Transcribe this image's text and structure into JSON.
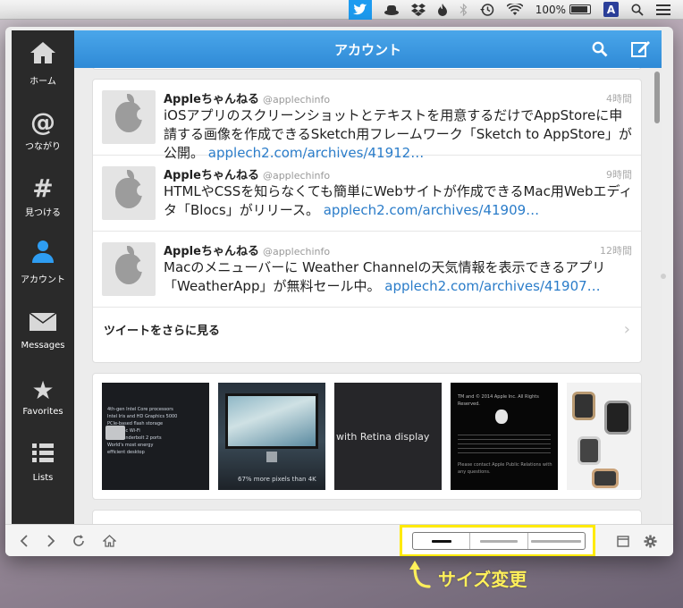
{
  "menubar": {
    "battery_text": "100%",
    "input_method": "A",
    "icons": [
      "twitter-icon",
      "hat-icon",
      "dropbox-icon",
      "flame-icon",
      "bluetooth-icon",
      "time-machine-icon",
      "wifi-icon",
      "battery-icon",
      "input-method-icon",
      "spotlight-icon",
      "menu-list-icon"
    ]
  },
  "sidebar": {
    "items": [
      {
        "label": "ホーム",
        "icon": "home-icon"
      },
      {
        "label": "つながり",
        "icon": "at-icon"
      },
      {
        "label": "見つける",
        "icon": "hashtag-icon"
      },
      {
        "label": "アカウント",
        "icon": "person-icon"
      },
      {
        "label": "Messages",
        "icon": "envelope-icon"
      },
      {
        "label": "Favorites",
        "icon": "star-icon"
      },
      {
        "label": "Lists",
        "icon": "list-icon"
      }
    ],
    "active_index": 3
  },
  "header": {
    "title": "アカウント"
  },
  "tweets": [
    {
      "name": "Appleちゃんねる",
      "handle": "@applechinfo",
      "time": "4時間",
      "text": "iOSアプリのスクリーンショットとテキストを用意するだけでAppStoreに申請する画像を作成できるSketch用フレームワーク「Sketch to AppStore」が公開。",
      "link": "applech2.com/archives/41912…"
    },
    {
      "name": "Appleちゃんねる",
      "handle": "@applechinfo",
      "time": "9時間",
      "text": "HTMLやCSSを知らなくても簡単にWebサイトが作成できるMac用Webエディタ「Blocs」がリリース。",
      "link": "applech2.com/archives/41909…"
    },
    {
      "name": "Appleちゃんねる",
      "handle": "@applechinfo",
      "time": "12時間",
      "text": "Macのメニューバーに Weather Channelの天気情報を表示できるアプリ「WeatherApp」が無料セール中。",
      "link": "applech2.com/archives/41907…"
    }
  ],
  "more_tweets_label": "ツイートをさらに見る",
  "media": [
    {
      "lines": [
        "4th-gen Intel Core processors",
        "Intel Iris and HD Graphics 5000",
        "PCIe-based flash storage",
        "802.11ac Wi-Fi",
        "Two Thunderbolt 2 ports",
        "World's most energy",
        "efficient desktop"
      ]
    },
    {
      "caption": "67% more pixels than 4K"
    },
    {
      "caption": "with Retina display"
    },
    {
      "lines": [
        "TM and © 2014 Apple Inc. All Rights Reserved."
      ],
      "footer": "Please contact Apple Public Relations with any questions."
    },
    {
      "caption": ""
    }
  ],
  "toolbar": {
    "size_options": [
      "small",
      "medium",
      "large"
    ],
    "selected_size": 0
  },
  "annotation": {
    "text": "サイズ変更"
  },
  "colors": {
    "header_blue": "#2f8ad6",
    "accent_yellow": "#ffea00",
    "link": "#2a7cc9",
    "active_icon": "#2e9df2"
  }
}
